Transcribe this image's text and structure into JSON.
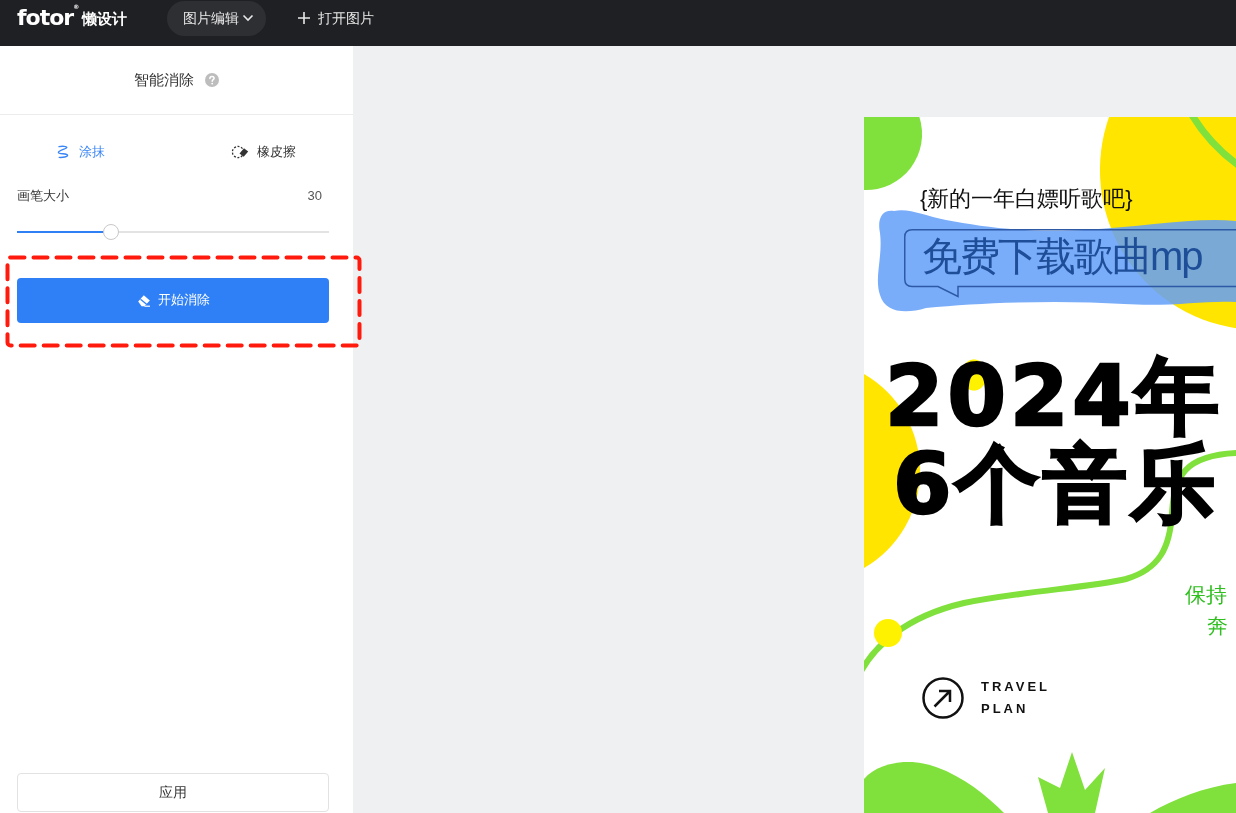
{
  "topbar": {
    "logo": {
      "wordmark": "fotor$^{®}$",
      "subtitle": "懒设计"
    },
    "menu_button": {
      "label": "图片编辑"
    },
    "open_button": {
      "label": "打开图片"
    }
  },
  "panel": {
    "title": "智能消除",
    "tools": [
      {
        "kind": "smear",
        "label": "涂抹",
        "selected": true
      },
      {
        "kind": "eraser",
        "label": "橡皮擦",
        "selected": false
      }
    ],
    "brush_size": {
      "label": "画笔大小",
      "reading": "30",
      "level": 0.3
    },
    "start_button": {
      "label": "开始消除",
      "highlighted": true
    },
    "apply_button": {
      "label": "应用"
    }
  },
  "poster": {
    "tagline": "{新的一年白嫖听歌吧}",
    "mask_painted": true,
    "banner": "免费下载歌曲mp",
    "headline": [
      "2024年",
      "6个音乐"
    ],
    "subtitle": [
      "保持",
      "奔"
    ],
    "brand": [
      "TRAVEL",
      "PLAN"
    ]
  }
}
